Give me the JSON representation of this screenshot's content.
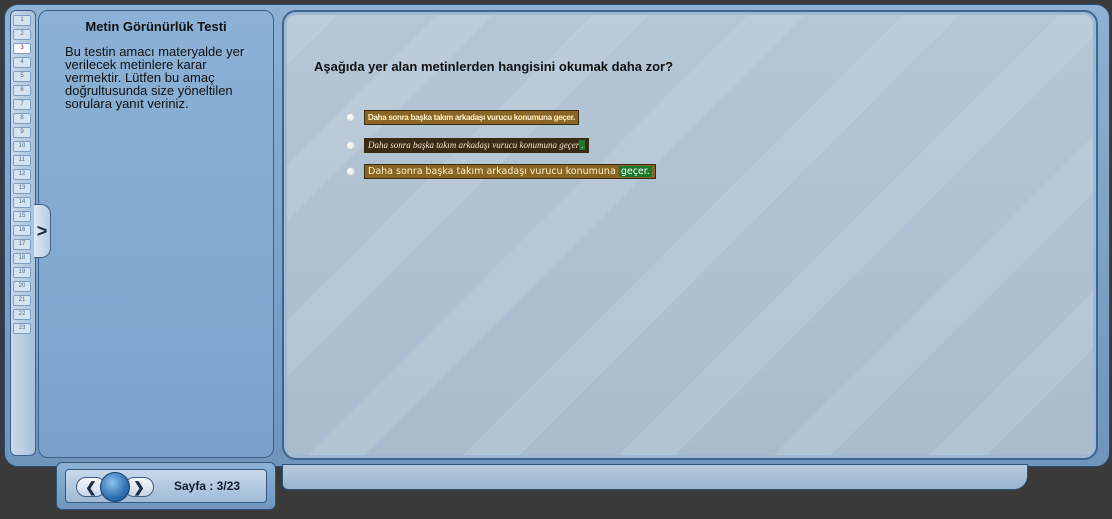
{
  "left_panel": {
    "title": "Metin Görünürlük Testi",
    "description": "Bu testin amacı materyalde yer verilecek metinlere karar vermektir. Lütfen bu amaç doğrultusunda size yöneltilen sorulara yanıt veriniz."
  },
  "tabs": [
    "1",
    "2",
    "3",
    "4",
    "5",
    "6",
    "7",
    "8",
    "9",
    "10",
    "11",
    "12",
    "13",
    "14",
    "15",
    "16",
    "17",
    "18",
    "19",
    "20",
    "21",
    "22",
    "23"
  ],
  "question": "Aşağıda yer alan metinlerden hangisini okumak daha zor?",
  "options": [
    {
      "text": "Daha sonra başka takım arkadaşı vurucu konumuna geçer."
    },
    {
      "text_main": "Daha sonra başka takım arkadaşı vurucu konumuna geçer",
      "text_hl": "."
    },
    {
      "text_main": "Daha sonra başka takım arkadaşı vurucu konumuna ",
      "text_hl": "geçer."
    }
  ],
  "nav": {
    "prev_icon": "chevron-left-icon",
    "next_icon": "chevron-right-icon",
    "prev_glyph": "❮",
    "next_glyph": "❯",
    "page_label": "Sayfa : 3/23"
  },
  "toggle_glyph": ">",
  "colors": {
    "panel_blue": "#7aa2cb",
    "content_bg": "#b5c6d6",
    "chip_brown": "#8a6626",
    "highlight_green": "#1b7a2b"
  }
}
